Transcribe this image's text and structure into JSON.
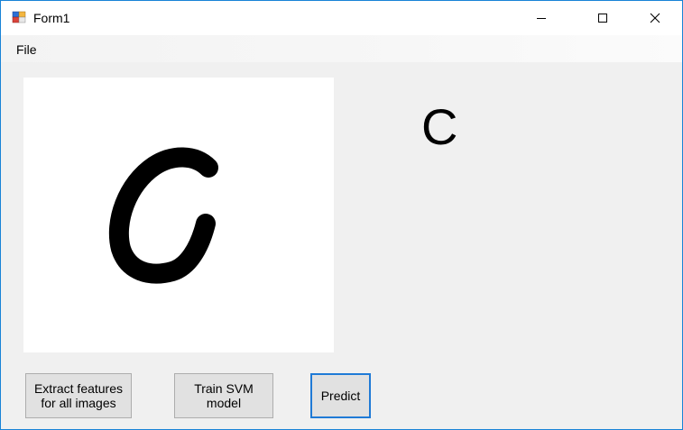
{
  "window": {
    "title": "Form1",
    "app_icon": "winforms-app-icon",
    "accent_border": "#1883d7",
    "controls": {
      "minimize_icon": "minimize-icon",
      "maximize_icon": "maximize-icon",
      "close_icon": "close-icon"
    }
  },
  "menu": {
    "items": [
      {
        "label": "File"
      }
    ]
  },
  "canvas": {
    "drawn_character": "C",
    "stroke_color": "#000000",
    "background": "#ffffff"
  },
  "prediction": {
    "label": "C"
  },
  "buttons": {
    "extract": "Extract features\nfor all images",
    "train": "Train SVM\nmodel",
    "predict": "Predict",
    "predict_focus_color": "#1f7ad6"
  }
}
